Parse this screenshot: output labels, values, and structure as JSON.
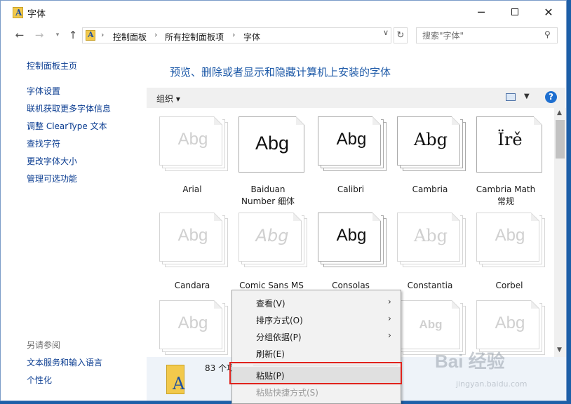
{
  "window": {
    "title": "字体"
  },
  "nav": {
    "breadcrumbs": [
      "控制面板",
      "所有控制面板项",
      "字体"
    ],
    "search_placeholder": "搜索\"字体\""
  },
  "left_pane": {
    "home": "控制面板主页",
    "links": [
      "字体设置",
      "联机获取更多字体信息",
      "调整 ClearType 文本",
      "查找字符",
      "更改字体大小",
      "管理可选功能"
    ],
    "see_also_heading": "另请参阅",
    "see_also": [
      "文本服务和输入语言",
      "个性化"
    ]
  },
  "main": {
    "title": "预览、删除或者显示和隐藏计算机上安装的字体",
    "organize": "组织 ▾",
    "fonts": [
      {
        "name": "Arial",
        "sample": "Abg"
      },
      {
        "name": "Baiduan Number 细体",
        "sample": "Abg"
      },
      {
        "name": "Calibri",
        "sample": "Abg"
      },
      {
        "name": "Cambria",
        "sample": "Abg"
      },
      {
        "name": "Cambria Math 常规",
        "sample": "Ïrě"
      },
      {
        "name": "Candara",
        "sample": "Abg"
      },
      {
        "name": "Comic Sans MS",
        "sample": "Abg"
      },
      {
        "name": "Consolas",
        "sample": "Abg"
      },
      {
        "name": "Constantia",
        "sample": "Abg"
      },
      {
        "name": "Corbel",
        "sample": "Abg"
      },
      {
        "name": "",
        "sample": "Abg"
      },
      {
        "name": "",
        "sample": "Abg"
      },
      {
        "name": "",
        "sample": "Abg"
      }
    ]
  },
  "details": {
    "count": "83 个项"
  },
  "context_menu": {
    "view": "查看(V)",
    "sort": "排序方式(O)",
    "group": "分组依据(P)",
    "refresh": "刷新(E)",
    "paste": "粘贴(P)",
    "paste_shortcut": "粘贴快捷方式(S)"
  },
  "watermark": {
    "main": "Bai 经验",
    "sub": "jingyan.baidu.com"
  },
  "colors": {
    "link": "#0b3d91",
    "title": "#1e5aa8",
    "highlight_box": "#e0221c"
  }
}
